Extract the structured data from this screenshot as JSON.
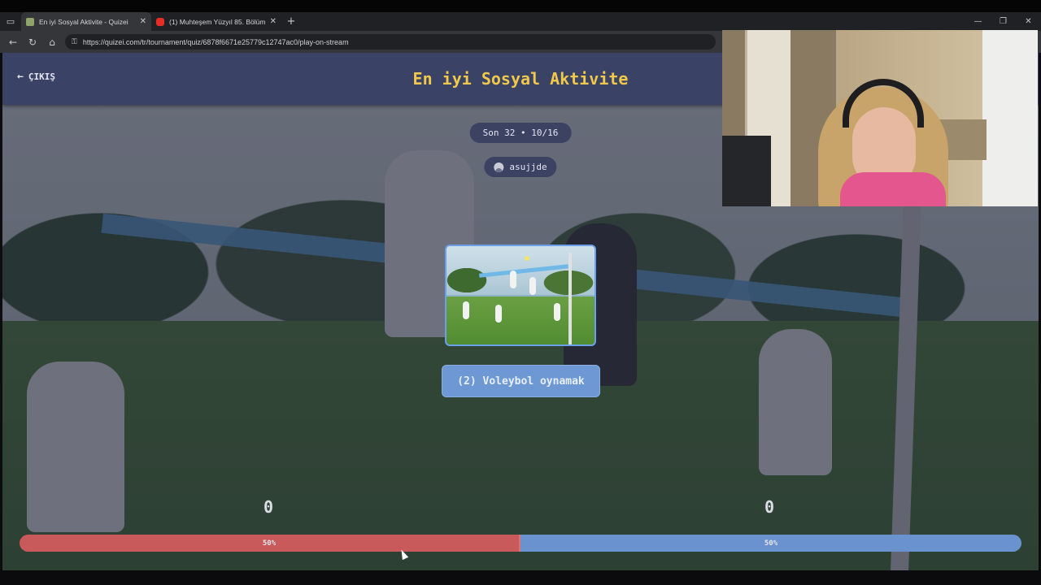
{
  "browser": {
    "tabs": [
      {
        "title": "En iyi Sosyal Aktivite - Quizei",
        "active": true
      },
      {
        "title": "(1) Muhteşem Yüzyıl 85. Bölüm (4",
        "active": false
      }
    ],
    "new_tab_label": "+",
    "url": "https://quizei.com/tr/tournament/quiz/6878f6671e25779c12747ac0/play-on-stream"
  },
  "header": {
    "exit_label": "ÇIKIŞ",
    "title": "En iyi Sosyal Aktivite"
  },
  "round_label": "Son 32 • 10/16",
  "username": "asujjde",
  "choice": {
    "label": "(2) Voleybol oynamak"
  },
  "scores": {
    "left": "0",
    "right": "0"
  },
  "progress": {
    "left_percent": 50,
    "right_percent": 50,
    "left_label": "50%",
    "right_label": "50%"
  },
  "colors": {
    "title": "#f0c84c",
    "left_bar": "#c85a5c",
    "right_bar": "#6a92cf",
    "header_bg": "#3a4265"
  },
  "icons": {
    "back": "arrow-left-icon",
    "user": "user-avatar-icon",
    "lock": "lock-icon"
  }
}
